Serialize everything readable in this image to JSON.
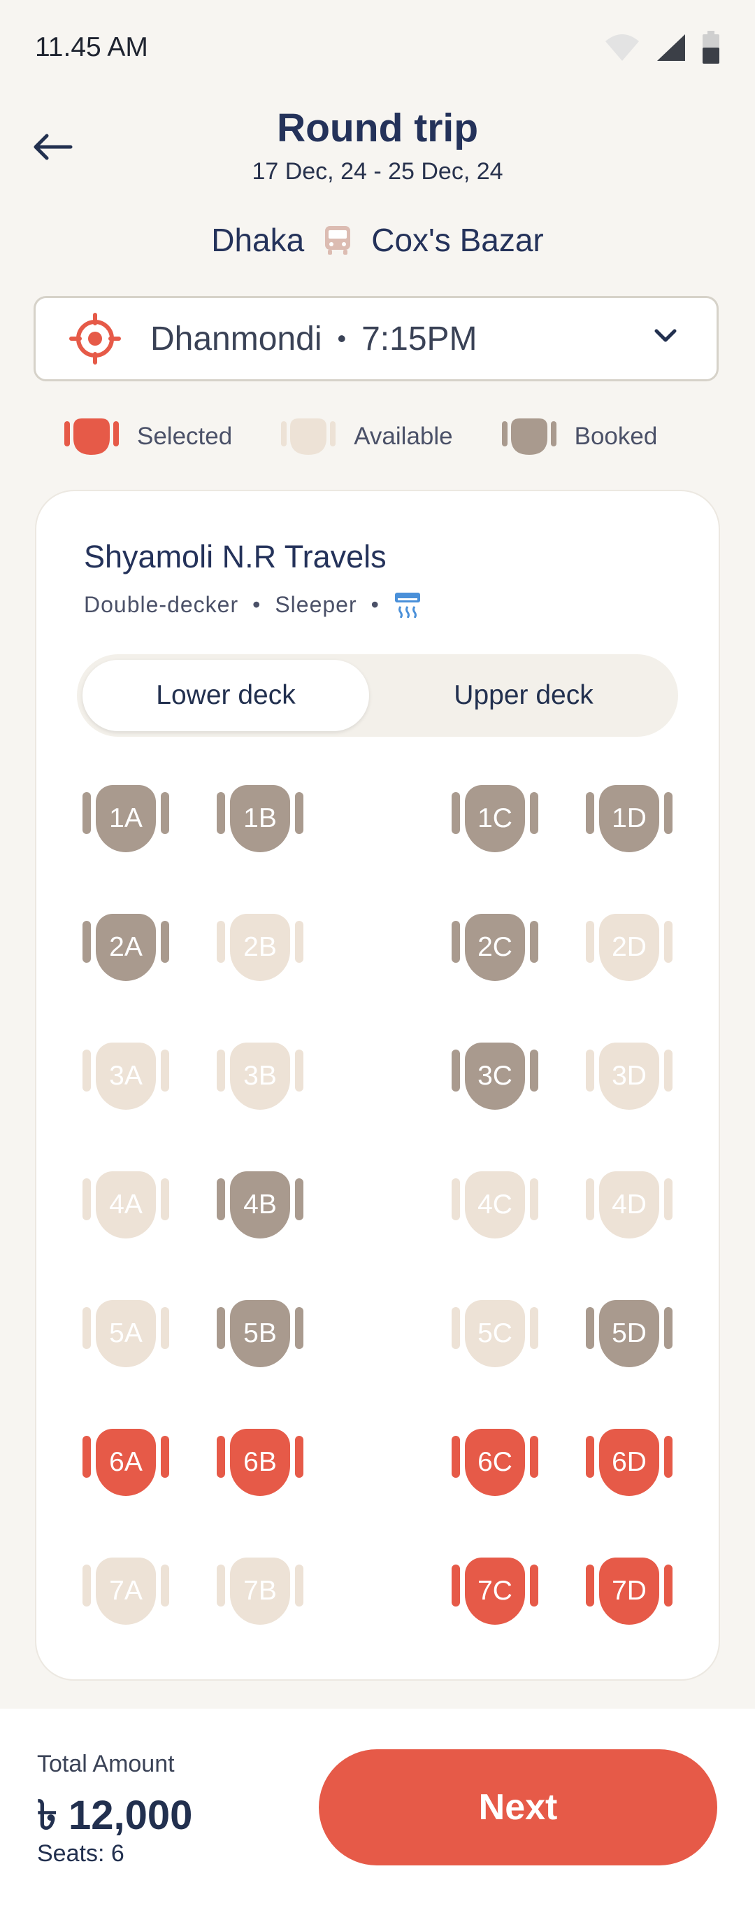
{
  "status_bar": {
    "time": "11.45 AM"
  },
  "header": {
    "title": "Round trip",
    "dates": "17 Dec, 24 - 25 Dec, 24",
    "origin": "Dhaka",
    "destination": "Cox's Bazar"
  },
  "boarding": {
    "place": "Dhanmondi",
    "separator": "•",
    "time": "7:15PM"
  },
  "legend": {
    "selected": "Selected",
    "available": "Available",
    "booked": "Booked"
  },
  "operator": {
    "name": "Shyamoli N.R Travels",
    "bus_type": "Double-decker",
    "berth": "Sleeper",
    "separator": "•"
  },
  "deck_tabs": {
    "lower": "Lower deck",
    "upper": "Upper deck",
    "active": "lower"
  },
  "seats": [
    {
      "label": "1A",
      "status": "booked"
    },
    {
      "label": "1B",
      "status": "booked"
    },
    {
      "label": "1C",
      "status": "booked"
    },
    {
      "label": "1D",
      "status": "booked"
    },
    {
      "label": "2A",
      "status": "booked"
    },
    {
      "label": "2B",
      "status": "available"
    },
    {
      "label": "2C",
      "status": "booked"
    },
    {
      "label": "2D",
      "status": "available"
    },
    {
      "label": "3A",
      "status": "available"
    },
    {
      "label": "3B",
      "status": "available"
    },
    {
      "label": "3C",
      "status": "booked"
    },
    {
      "label": "3D",
      "status": "available"
    },
    {
      "label": "4A",
      "status": "available"
    },
    {
      "label": "4B",
      "status": "booked"
    },
    {
      "label": "4C",
      "status": "available"
    },
    {
      "label": "4D",
      "status": "available"
    },
    {
      "label": "5A",
      "status": "available"
    },
    {
      "label": "5B",
      "status": "booked"
    },
    {
      "label": "5C",
      "status": "available"
    },
    {
      "label": "5D",
      "status": "booked"
    },
    {
      "label": "6A",
      "status": "selected"
    },
    {
      "label": "6B",
      "status": "selected"
    },
    {
      "label": "6C",
      "status": "selected"
    },
    {
      "label": "6D",
      "status": "selected"
    },
    {
      "label": "7A",
      "status": "available"
    },
    {
      "label": "7B",
      "status": "available"
    },
    {
      "label": "7C",
      "status": "selected"
    },
    {
      "label": "7D",
      "status": "selected"
    }
  ],
  "colors": {
    "selected": "#e65a48",
    "available": "#ede2d6",
    "booked": "#a99a8e",
    "ac": "#4a90d9"
  },
  "footer": {
    "total_label": "Total Amount",
    "total_amount": "৳ 12,000",
    "seats": "Seats: 6",
    "next_label": "Next"
  }
}
